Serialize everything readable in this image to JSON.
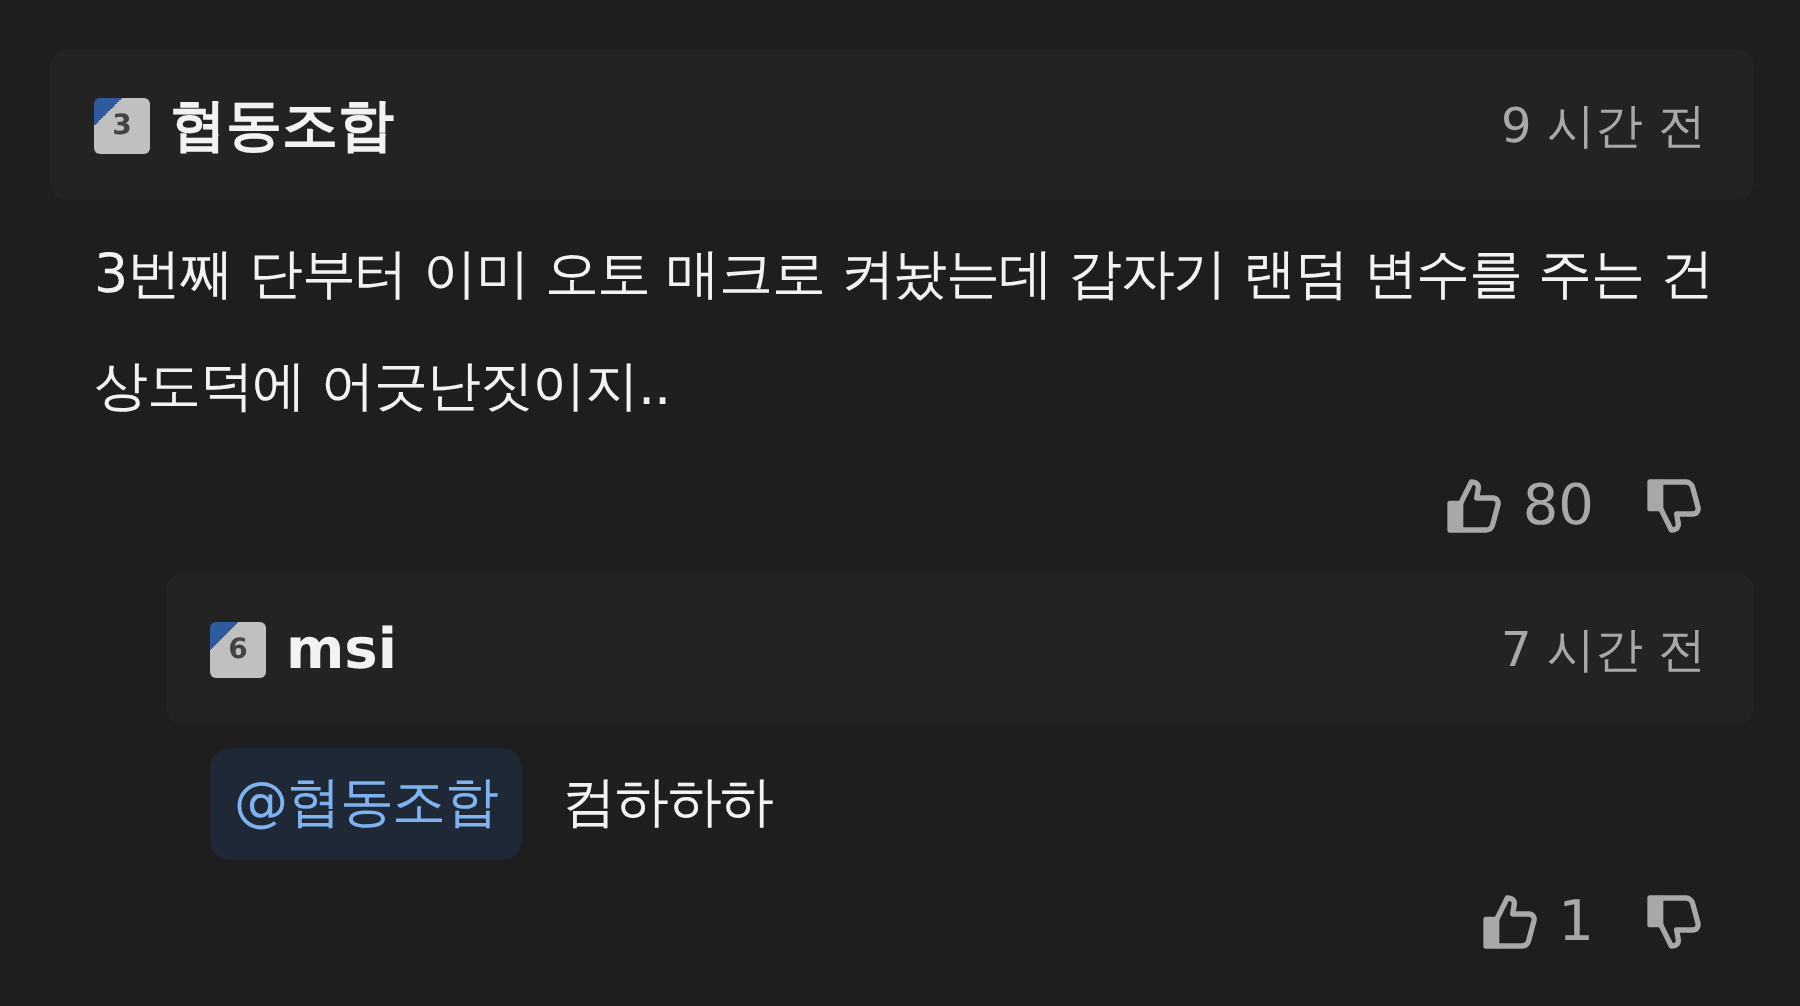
{
  "comments": [
    {
      "level": "3",
      "author": "협동조합",
      "time": "9 시간 전",
      "text": "3번째 단부터 이미 오토 매크로 켜놨는데 갑자기 랜덤 변수를 주는 건 상도덕에 어긋난짓이지..",
      "likes": "80"
    },
    {
      "level": "6",
      "author": "msi",
      "time": "7 시간 전",
      "mention": "@협동조합",
      "text": "컴하하하",
      "likes": "1"
    }
  ]
}
